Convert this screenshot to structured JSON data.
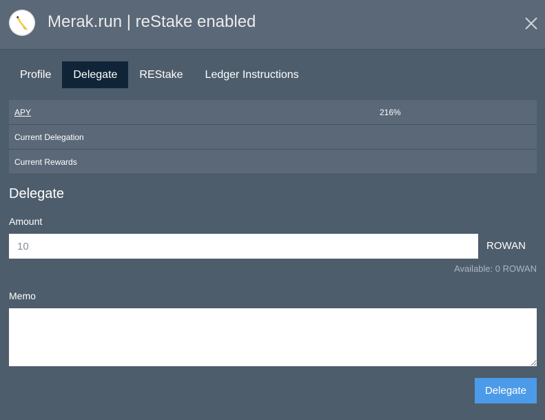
{
  "header": {
    "title": "Merak.run | reStake enabled",
    "avatar_icon": "validator-logo-icon",
    "close_icon": "close-icon"
  },
  "tabs": [
    {
      "label": "Profile",
      "active": false
    },
    {
      "label": "Delegate",
      "active": true
    },
    {
      "label": "REStake",
      "active": false
    },
    {
      "label": "Ledger Instructions",
      "active": false
    }
  ],
  "info": {
    "apy_label": "APY",
    "apy_value": "216%",
    "delegation_label": "Current Delegation",
    "delegation_value": "",
    "rewards_label": "Current Rewards",
    "rewards_value": ""
  },
  "form": {
    "section_title": "Delegate",
    "amount_label": "Amount",
    "amount_placeholder": "10",
    "amount_unit": "ROWAN",
    "available": "Available: 0 ROWAN",
    "memo_label": "Memo",
    "memo_value": "",
    "submit_label": "Delegate"
  },
  "colors": {
    "background": "#4e5d6c",
    "header": "#5a6878",
    "active_tab": "#0f2537",
    "primary_button": "#4c9be8"
  }
}
